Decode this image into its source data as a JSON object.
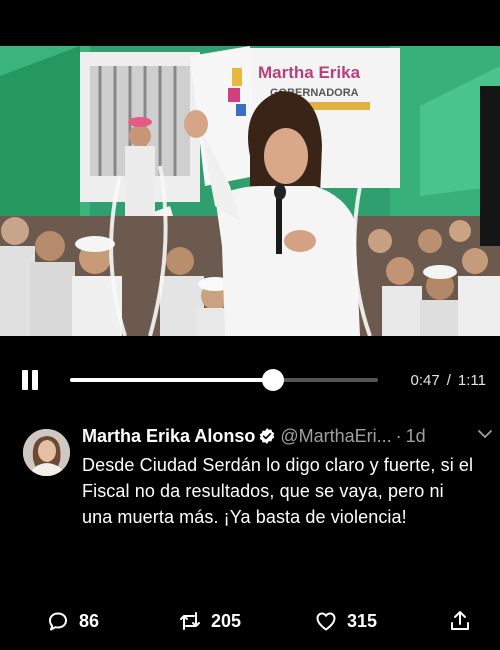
{
  "player": {
    "current_time": "0:47",
    "separator": "/",
    "duration": "1:11",
    "progress_fraction": 0.66,
    "state": "playing"
  },
  "video": {
    "banner_text": "Martha Erika",
    "banner_sub": "GOBERNADORA"
  },
  "tweet": {
    "author_name": "Martha Erika Alonso",
    "handle": "@MarthaEri...",
    "separator": "·",
    "time_ago": "1d",
    "text": "Desde Ciudad Serdán lo digo claro y fuerte, si el Fiscal no da resultados, que se vaya, pero ni una muerta más. ¡Ya basta de violencia!",
    "replies": "86",
    "retweets": "205",
    "likes": "315"
  },
  "colors": {
    "background": "#000000",
    "verified": "#ffffff",
    "muted_text": "#a0a0a0",
    "track": "#555555"
  },
  "icons": {
    "play_pause": "pause-icon",
    "verified": "verified-badge-icon",
    "menu": "chevron-down-icon",
    "reply": "reply-icon",
    "retweet": "retweet-icon",
    "like": "heart-icon",
    "share": "share-icon"
  }
}
